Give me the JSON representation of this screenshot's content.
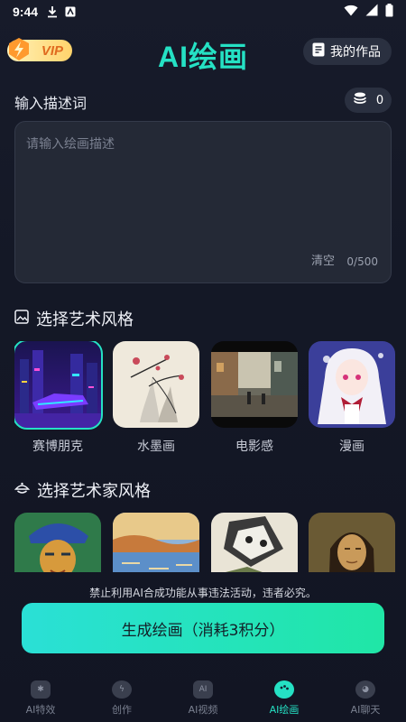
{
  "status_bar": {
    "time": "9:44"
  },
  "header": {
    "vip_label": "VIP",
    "title": "AI绘画",
    "my_works_label": "我的作品"
  },
  "description": {
    "label": "输入描述词",
    "credits": "0",
    "placeholder": "请输入绘画描述",
    "clear_label": "清空",
    "char_count": "0/500"
  },
  "art_styles": {
    "title": "选择艺术风格",
    "items": [
      {
        "label": "赛博朋克"
      },
      {
        "label": "水墨画"
      },
      {
        "label": "电影感"
      },
      {
        "label": "漫画"
      }
    ]
  },
  "artist_styles": {
    "title": "选择艺术家风格"
  },
  "notice": "禁止利用AI合成功能从事违法活动，违者必究。",
  "generate_button": "生成绘画（消耗3积分）",
  "tabs": [
    {
      "label": "AI特效",
      "icon": ""
    },
    {
      "label": "创作",
      "icon": ""
    },
    {
      "label": "AI视频",
      "icon": "AI"
    },
    {
      "label": "AI绘画",
      "icon": ""
    },
    {
      "label": "AI聊天",
      "icon": ""
    }
  ],
  "colors": {
    "accent": "#25e1c4",
    "background": "#151926",
    "button_gradient_end": "#20e6a6"
  }
}
